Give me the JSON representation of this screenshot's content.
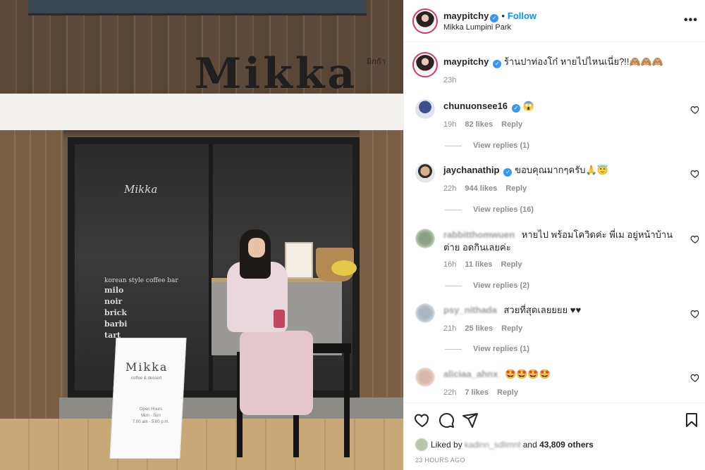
{
  "photo": {
    "sign_text": "Mikka",
    "sign_sub": "มิกก้า",
    "window_lines": [
      "Mikka",
      "korean style coffee bar",
      "milo",
      "noir",
      "brick",
      "barbi",
      "tart"
    ],
    "aframe_title": "Mikka",
    "aframe_sub": "coffee & dessert",
    "aframe_hours": "Open Hours\nMon - Sun\n7.00 am - 5.00 p.m."
  },
  "post": {
    "author": "maypitchy",
    "follow_label": "Follow",
    "separator": "•",
    "location": "Mikka Lumpini Park",
    "more_label": "•••"
  },
  "caption": {
    "username": "maypitchy",
    "text": "ร้านปาท่องโก๋ หายไปไหนเนี่ย?!!🙈🙈🙈",
    "time": "23h"
  },
  "comments": [
    {
      "username": "chunuonsee16",
      "verified": true,
      "text": "😱",
      "time": "19h",
      "likes": "82 likes",
      "reply_label": "Reply",
      "view_replies": "View replies (1)"
    },
    {
      "username": "jaychanathip",
      "verified": true,
      "text": "ขอบคุณมากๆครับ🙏😇",
      "time": "22h",
      "likes": "944 likes",
      "reply_label": "Reply",
      "view_replies": "View replies (16)"
    },
    {
      "username": "rabbitthomwuen",
      "verified": false,
      "text": "หายไป พร้อมโควิดค่ะ พี่เม อยู่หน้าบ้านต่าย อดกินเลยค่ะ",
      "time": "16h",
      "likes": "11 likes",
      "reply_label": "Reply",
      "view_replies": "View replies (2)"
    },
    {
      "username": "psy_nithada",
      "verified": false,
      "text": "สวยที่สุดเลยยยย ♥♥",
      "time": "21h",
      "likes": "25 likes",
      "reply_label": "Reply",
      "view_replies": "View replies (1)"
    },
    {
      "username": "aliciaa_ahnx",
      "verified": false,
      "text": "🤩🤩🤩🤩",
      "time": "22h",
      "likes": "7 likes",
      "reply_label": "Reply"
    }
  ],
  "actions": {
    "liked_by_prefix": "Liked by",
    "liked_by_user": "kadinn_sdlimnt",
    "liked_by_connector": "and",
    "liked_by_count": "43,809 others",
    "time_ago": "23 HOURS AGO"
  },
  "icons": [
    "heart-icon",
    "comment-icon",
    "share-icon",
    "bookmark-icon",
    "more-icon",
    "verified-icon"
  ],
  "colors": {
    "follow": "#0095f6",
    "verified": "#3897f0",
    "meta": "#8e8e8e",
    "text": "#262626"
  }
}
